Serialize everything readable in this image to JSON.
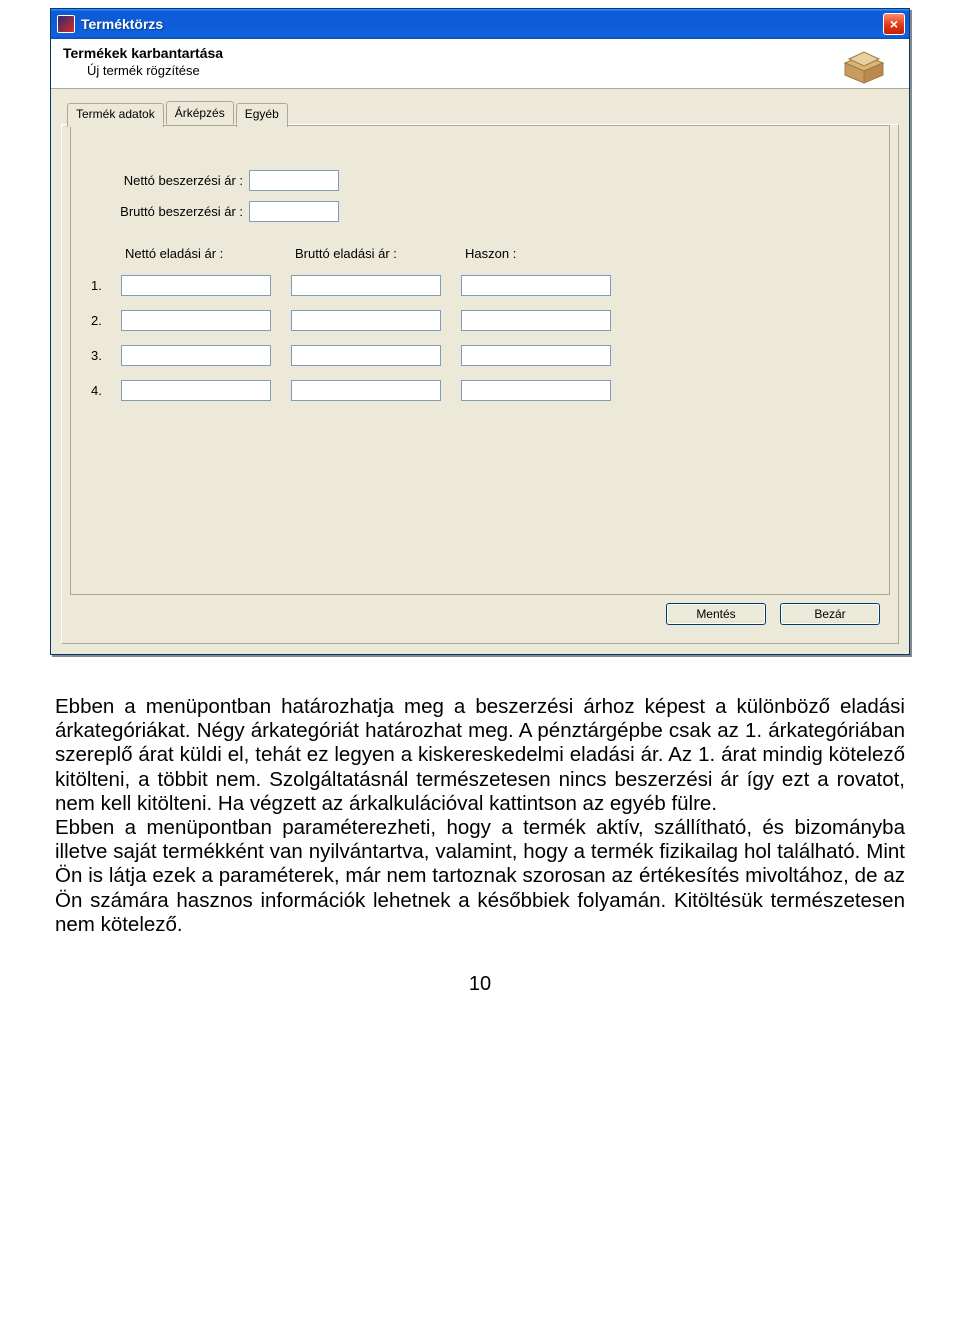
{
  "window": {
    "title": "Terméktörzs",
    "close_label": "×"
  },
  "subheader": {
    "title": "Termékek karbantartása",
    "subtitle": "Új termék rögzítése"
  },
  "tabs": {
    "product_data": "Termék adatok",
    "pricing": "Árképzés",
    "other": "Egyéb"
  },
  "form": {
    "net_purchase_label": "Nettó beszerzési ár :",
    "gross_purchase_label": "Bruttó beszerzési ár :",
    "net_purchase_value": "",
    "gross_purchase_value": ""
  },
  "grid": {
    "headers": {
      "net_sale": "Nettó eladási ár :",
      "gross_sale": "Bruttó eladási ár :",
      "profit": "Haszon :"
    },
    "rows": [
      {
        "num": "1.",
        "net": "",
        "gross": "",
        "profit": ""
      },
      {
        "num": "2.",
        "net": "",
        "gross": "",
        "profit": ""
      },
      {
        "num": "3.",
        "net": "",
        "gross": "",
        "profit": ""
      },
      {
        "num": "4.",
        "net": "",
        "gross": "",
        "profit": ""
      }
    ]
  },
  "buttons": {
    "save": "Mentés",
    "close": "Bezár"
  },
  "document": {
    "paragraph": "Ebben a menüpontban határozhatja meg a beszerzési árhoz képest a különböző eladási árkategóriákat. Négy árkategóriát határozhat meg. A pénztárgépbe csak az 1. árkategóriában szereplő árat küldi el, tehát ez legyen a kiskereskedelmi eladási ár. Az 1. árat mindig kötelező kitölteni, a többit nem. Szolgáltatásnál természetesen nincs beszerzési ár így ezt a rovatot, nem kell kitölteni. Ha végzett az árkalkulációval kattintson az egyéb fülre.",
    "paragraph2": "Ebben a menüpontban paraméterezheti, hogy a termék aktív, szállítható, és bizományba illetve saját termékként van nyilvántartva, valamint, hogy a termék fizikailag hol található. Mint Ön is látja ezek a paraméterek, már nem tartoznak szorosan az értékesítés mivoltához, de az Ön számára hasznos információk lehetnek a későbbiek folyamán. Kitöltésük természetesen nem kötelező.",
    "pagenum": "10"
  }
}
